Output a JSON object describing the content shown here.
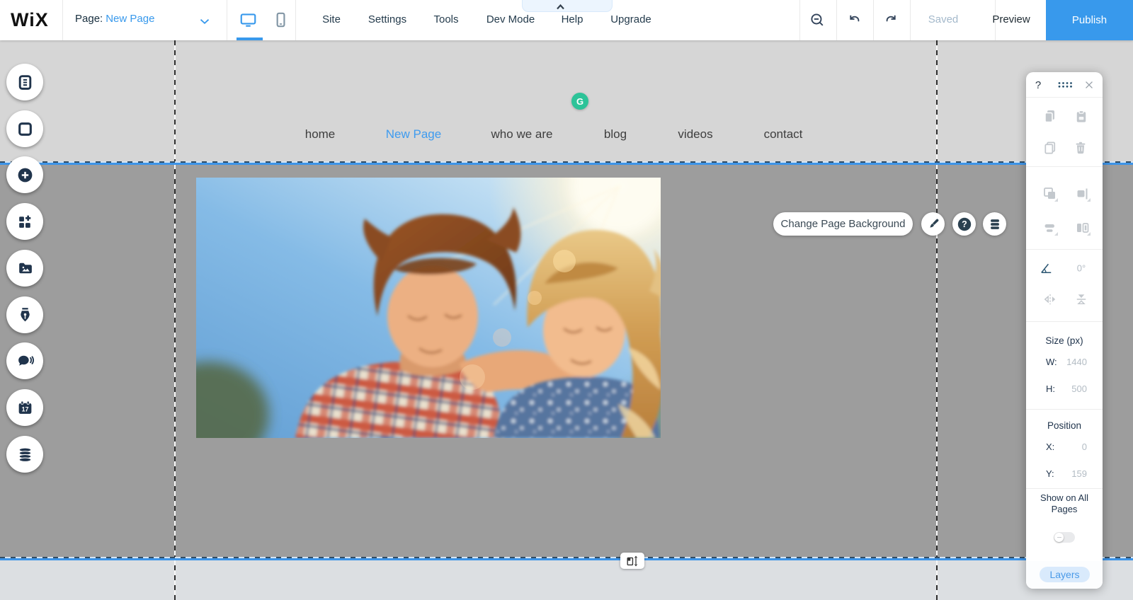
{
  "colors": {
    "accent": "#3899ec",
    "publish_bg": "#3899ec",
    "grammarly_green": "#2cc398",
    "panel_icon_gray": "#c3c8cd",
    "dark_navy": "#20344c",
    "layers_pill_bg": "#d9eafc",
    "layers_pill_text": "#4a9ae8"
  },
  "topbar": {
    "logo": "WiX",
    "page_label": "Page:",
    "page_value": "New Page",
    "menu": [
      "Site",
      "Settings",
      "Tools",
      "Dev Mode",
      "Help",
      "Upgrade"
    ],
    "saved_label": "Saved",
    "preview_label": "Preview",
    "publish_label": "Publish",
    "icons": [
      "desktop-icon",
      "mobile-icon",
      "zoom-out-icon",
      "undo-icon",
      "redo-icon",
      "chevron-down-icon",
      "caret-up-icon"
    ]
  },
  "left_toolbar": {
    "bookings_day": "17",
    "items": [
      {
        "name": "menus-pages"
      },
      {
        "name": "page-background"
      },
      {
        "name": "add-elements"
      },
      {
        "name": "add-apps"
      },
      {
        "name": "media"
      },
      {
        "name": "blog"
      },
      {
        "name": "chat"
      },
      {
        "name": "bookings"
      },
      {
        "name": "content-manager"
      }
    ]
  },
  "canvas": {
    "nav": [
      {
        "label": "home",
        "active": false
      },
      {
        "label": "New Page",
        "active": true
      },
      {
        "label": "who we are",
        "active": false
      },
      {
        "label": "blog",
        "active": false
      },
      {
        "label": "videos",
        "active": false
      },
      {
        "label": "contact",
        "active": false
      }
    ],
    "grammarly_badge": "G",
    "change_background_label": "Change Page Background",
    "help_badge": "?"
  },
  "right_panel": {
    "help_label": "?",
    "rotation_value": "0°",
    "size_title": "Size (px)",
    "width_label": "W:",
    "width_value": "1440",
    "height_label": "H:",
    "height_value": "500",
    "position_title": "Position",
    "x_label": "X:",
    "x_value": "0",
    "y_label": "Y:",
    "y_value": "159",
    "show_on_all_pages_label": "Show on All Pages",
    "layers_label": "Layers"
  }
}
